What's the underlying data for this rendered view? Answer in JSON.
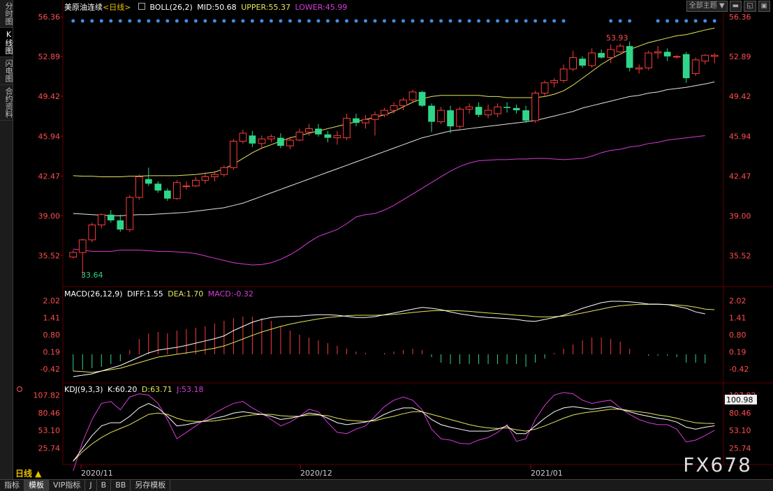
{
  "sidebar": {
    "tabs": [
      {
        "label": "分时图",
        "active": false
      },
      {
        "label": "K线图",
        "active": true
      },
      {
        "label": "闪电图",
        "active": false
      },
      {
        "label": "合约资料",
        "active": false
      }
    ]
  },
  "toolbar": {
    "theme_label": "全部主题",
    "theme_arrow": "▼"
  },
  "price_panel": {
    "instrument": "美原油连续",
    "period_tag": "<日线>",
    "indicator": "BOLL(26,2)",
    "mid": "MID:50.68",
    "upper": "UPPER:55.37",
    "lower": "LOWER:45.99",
    "y_ticks": [
      "56.36",
      "52.89",
      "49.42",
      "45.94",
      "42.47",
      "39.00",
      "35.52"
    ],
    "high_label": "53.93",
    "low_label": "33.64"
  },
  "macd_panel": {
    "indicator": "MACD(26,12,9)",
    "diff": "DIFF:1.55",
    "dea": "DEA:1.70",
    "macd": "MACD:-0.32",
    "y_ticks": [
      "2.02",
      "1.41",
      "0.80",
      "0.19",
      "-0.42"
    ]
  },
  "kdj_panel": {
    "indicator": "KDJ(9,3,3)",
    "k": "K:60.20",
    "d": "D:63.71",
    "j": "J:53.18",
    "y_ticks": [
      "107.82",
      "80.46",
      "53.10",
      "25.74"
    ],
    "current_value": "100.98"
  },
  "x_axis": {
    "labels": [
      "2020/11",
      "2020/12",
      "2021/01"
    ]
  },
  "period_button": "日线 ▲",
  "bottom_tabs": [
    "指标",
    "模板",
    "VIP指标",
    "J",
    "B",
    "BB",
    "另存模板"
  ],
  "bottom_active": "模板",
  "watermark": "FX678",
  "colors": {
    "up": "#ff3b3b",
    "down": "#2fd68a",
    "mid": "#e6e6e6",
    "upper": "#e6e65a",
    "lower": "#d93ad9",
    "diff": "#ffffff",
    "dea": "#e6e65a",
    "j": "#d93ad9",
    "k": "#ffffff",
    "d": "#e6e65a"
  },
  "chart_data": [
    {
      "type": "candlestick",
      "title": "美原油连续<日线>",
      "ylim": [
        33.0,
        56.36
      ],
      "candles": [
        [
          35.4,
          36.0,
          35.3,
          35.8
        ],
        [
          35.8,
          37.0,
          33.64,
          36.9
        ],
        [
          36.9,
          38.4,
          36.7,
          38.2
        ],
        [
          38.2,
          39.2,
          37.9,
          39.1
        ],
        [
          39.1,
          39.5,
          38.4,
          38.6
        ],
        [
          38.6,
          39.1,
          37.6,
          37.8
        ],
        [
          37.8,
          40.8,
          37.6,
          40.6
        ],
        [
          40.6,
          42.6,
          40.4,
          42.4
        ],
        [
          42.2,
          43.2,
          41.6,
          41.8
        ],
        [
          41.8,
          42.0,
          41.0,
          41.2
        ],
        [
          41.2,
          41.4,
          40.3,
          40.5
        ],
        [
          40.5,
          42.1,
          40.4,
          41.9
        ],
        [
          41.6,
          42.0,
          41.3,
          41.6
        ],
        [
          41.6,
          42.4,
          41.5,
          42.1
        ],
        [
          42.1,
          42.8,
          41.8,
          42.4
        ],
        [
          42.4,
          42.9,
          42.0,
          42.6
        ],
        [
          42.6,
          43.4,
          42.4,
          43.2
        ],
        [
          43.2,
          45.7,
          43.0,
          45.5
        ],
        [
          45.5,
          46.5,
          45.3,
          46.2
        ],
        [
          46.0,
          46.4,
          45.0,
          45.3
        ],
        [
          45.3,
          46.0,
          44.9,
          45.7
        ],
        [
          45.7,
          46.1,
          45.4,
          45.9
        ],
        [
          45.8,
          46.2,
          44.9,
          45.1
        ],
        [
          45.1,
          45.9,
          44.8,
          45.6
        ],
        [
          45.6,
          46.6,
          45.5,
          46.3
        ],
        [
          46.3,
          47.0,
          46.0,
          46.6
        ],
        [
          46.6,
          47.0,
          45.9,
          46.1
        ],
        [
          46.1,
          46.4,
          45.4,
          45.8
        ],
        [
          45.8,
          46.4,
          45.2,
          46.0
        ],
        [
          45.8,
          47.9,
          45.6,
          47.5
        ],
        [
          47.5,
          47.9,
          46.8,
          47.1
        ],
        [
          47.1,
          47.8,
          46.6,
          47.4
        ],
        [
          47.4,
          48.1,
          46.0,
          47.8
        ],
        [
          47.8,
          48.4,
          47.6,
          48.2
        ],
        [
          48.2,
          48.9,
          47.9,
          48.6
        ],
        [
          48.6,
          49.3,
          48.2,
          49.1
        ],
        [
          49.1,
          50.0,
          48.9,
          49.8
        ],
        [
          49.8,
          49.9,
          48.5,
          48.6
        ],
        [
          48.6,
          48.8,
          46.3,
          47.2
        ],
        [
          47.2,
          48.5,
          47.0,
          48.2
        ],
        [
          48.2,
          48.6,
          46.2,
          46.8
        ],
        [
          46.8,
          48.5,
          46.6,
          48.3
        ],
        [
          48.3,
          48.8,
          47.9,
          48.5
        ],
        [
          48.5,
          48.9,
          47.6,
          47.8
        ],
        [
          47.8,
          48.7,
          47.5,
          48.2
        ],
        [
          47.9,
          48.8,
          47.6,
          48.5
        ],
        [
          48.5,
          48.9,
          48.0,
          48.4
        ],
        [
          48.4,
          48.7,
          47.9,
          48.2
        ],
        [
          48.2,
          48.6,
          47.1,
          47.3
        ],
        [
          47.3,
          49.9,
          47.1,
          49.7
        ],
        [
          49.7,
          50.8,
          49.4,
          50.6
        ],
        [
          50.6,
          51.0,
          50.2,
          50.8
        ],
        [
          50.8,
          52.2,
          50.6,
          51.8
        ],
        [
          51.8,
          53.4,
          51.6,
          52.8
        ],
        [
          52.7,
          52.9,
          51.9,
          52.1
        ],
        [
          52.1,
          53.6,
          51.9,
          53.2
        ],
        [
          53.2,
          53.5,
          52.7,
          52.8
        ],
        [
          52.8,
          53.93,
          52.3,
          53.5
        ],
        [
          53.3,
          54.0,
          53.2,
          53.8
        ],
        [
          53.8,
          54.2,
          51.6,
          51.9
        ],
        [
          51.8,
          52.2,
          51.4,
          51.9
        ],
        [
          51.9,
          53.4,
          51.7,
          53.2
        ],
        [
          53.2,
          53.8,
          52.7,
          53.3
        ],
        [
          53.3,
          53.6,
          52.5,
          52.9
        ],
        [
          52.9,
          53.0,
          52.7,
          52.9
        ],
        [
          53.1,
          53.3,
          50.6,
          51.0
        ],
        [
          51.4,
          52.8,
          51.2,
          52.6
        ],
        [
          52.5,
          53.1,
          52.2,
          53.0
        ],
        [
          52.9,
          53.2,
          52.3,
          53.0
        ]
      ],
      "mid": [
        39.2,
        39.15,
        39.1,
        39.05,
        39.0,
        39.0,
        39.05,
        39.1,
        39.1,
        39.15,
        39.2,
        39.25,
        39.3,
        39.4,
        39.5,
        39.6,
        39.7,
        39.9,
        40.1,
        40.4,
        40.7,
        41.0,
        41.3,
        41.6,
        41.9,
        42.2,
        42.5,
        42.8,
        43.1,
        43.4,
        43.7,
        44.0,
        44.3,
        44.6,
        44.9,
        45.2,
        45.5,
        45.8,
        46.0,
        46.2,
        46.4,
        46.5,
        46.6,
        46.7,
        46.8,
        46.9,
        47.0,
        47.1,
        47.2,
        47.3,
        47.5,
        47.7,
        47.9,
        48.1,
        48.4,
        48.6,
        48.8,
        49.0,
        49.2,
        49.4,
        49.5,
        49.7,
        49.8,
        50.0,
        50.1,
        50.2,
        50.35,
        50.5,
        50.68
      ],
      "upper": [
        42.5,
        42.45,
        42.45,
        42.4,
        42.4,
        42.4,
        42.45,
        42.45,
        42.5,
        42.5,
        42.5,
        42.5,
        42.55,
        42.6,
        42.7,
        42.8,
        43.1,
        43.5,
        44.0,
        44.5,
        44.9,
        45.2,
        45.5,
        45.8,
        46.0,
        46.2,
        46.4,
        46.6,
        46.8,
        47.0,
        47.2,
        47.4,
        47.6,
        47.8,
        48.1,
        48.5,
        48.9,
        49.2,
        49.4,
        49.5,
        49.5,
        49.5,
        49.5,
        49.5,
        49.4,
        49.4,
        49.3,
        49.3,
        49.3,
        49.3,
        49.4,
        49.6,
        49.9,
        50.4,
        51.0,
        51.6,
        52.2,
        52.7,
        53.1,
        53.5,
        53.8,
        54.1,
        54.3,
        54.5,
        54.7,
        54.8,
        55.0,
        55.2,
        55.37
      ],
      "lower": [
        36.1,
        36.0,
        35.9,
        35.9,
        35.9,
        36.0,
        36.0,
        36.0,
        35.95,
        35.9,
        35.9,
        35.85,
        35.8,
        35.7,
        35.5,
        35.3,
        35.1,
        34.9,
        34.8,
        34.7,
        34.75,
        34.9,
        35.2,
        35.6,
        36.1,
        36.7,
        37.2,
        37.5,
        37.8,
        38.3,
        38.9,
        39.1,
        39.2,
        39.5,
        39.9,
        40.4,
        40.9,
        41.4,
        41.9,
        42.4,
        42.9,
        43.3,
        43.6,
        43.8,
        43.85,
        43.9,
        43.9,
        43.95,
        43.95,
        44.0,
        44.0,
        43.95,
        43.9,
        43.95,
        44.0,
        44.2,
        44.5,
        44.7,
        44.8,
        45.0,
        45.1,
        45.3,
        45.4,
        45.6,
        45.7,
        45.8,
        45.9,
        45.99
      ]
    },
    {
      "type": "bar+line",
      "title": "MACD(26,12,9)",
      "ylim": [
        -0.85,
        2.2
      ],
      "hist": [
        -0.6,
        -0.55,
        -0.5,
        -0.45,
        -0.35,
        -0.25,
        0.15,
        0.55,
        0.75,
        0.8,
        0.75,
        0.85,
        0.9,
        0.95,
        1.0,
        1.1,
        1.2,
        1.3,
        1.35,
        1.35,
        1.3,
        1.2,
        1.0,
        0.85,
        0.7,
        0.6,
        0.5,
        0.4,
        0.3,
        0.2,
        0.1,
        0.05,
        0.0,
        0.05,
        0.1,
        0.15,
        0.2,
        0.15,
        -0.1,
        -0.3,
        -0.35,
        -0.35,
        -0.35,
        -0.35,
        -0.35,
        -0.35,
        -0.35,
        -0.35,
        -0.45,
        -0.3,
        -0.15,
        0.05,
        0.2,
        0.35,
        0.5,
        0.6,
        0.6,
        0.55,
        0.45,
        0.2,
        0.0,
        -0.05,
        -0.05,
        -0.05,
        -0.1,
        -0.3,
        -0.3,
        -0.32
      ],
      "diff": [
        -0.7,
        -0.65,
        -0.6,
        -0.5,
        -0.4,
        -0.3,
        -0.15,
        0.0,
        0.15,
        0.25,
        0.3,
        0.35,
        0.42,
        0.5,
        0.58,
        0.66,
        0.76,
        0.95,
        1.1,
        1.25,
        1.35,
        1.42,
        1.45,
        1.46,
        1.47,
        1.5,
        1.52,
        1.52,
        1.5,
        1.46,
        1.42,
        1.42,
        1.45,
        1.52,
        1.58,
        1.65,
        1.72,
        1.78,
        1.75,
        1.7,
        1.62,
        1.55,
        1.5,
        1.45,
        1.42,
        1.4,
        1.38,
        1.35,
        1.3,
        1.28,
        1.35,
        1.42,
        1.5,
        1.62,
        1.75,
        1.85,
        1.95,
        2.0,
        2.0,
        1.98,
        1.95,
        1.9,
        1.9,
        1.88,
        1.82,
        1.75,
        1.62,
        1.55
      ],
      "dea": [
        -0.5,
        -0.52,
        -0.55,
        -0.5,
        -0.45,
        -0.4,
        -0.3,
        -0.2,
        -0.1,
        0.0,
        0.05,
        0.1,
        0.15,
        0.2,
        0.26,
        0.32,
        0.4,
        0.52,
        0.65,
        0.78,
        0.9,
        1.0,
        1.1,
        1.18,
        1.25,
        1.31,
        1.37,
        1.42,
        1.45,
        1.48,
        1.5,
        1.5,
        1.5,
        1.51,
        1.53,
        1.56,
        1.6,
        1.63,
        1.66,
        1.67,
        1.67,
        1.66,
        1.64,
        1.61,
        1.58,
        1.56,
        1.53,
        1.5,
        1.48,
        1.45,
        1.44,
        1.45,
        1.47,
        1.52,
        1.58,
        1.65,
        1.72,
        1.79,
        1.84,
        1.87,
        1.89,
        1.89,
        1.89,
        1.88,
        1.87,
        1.84,
        1.79,
        1.72,
        1.7
      ]
    },
    {
      "type": "line",
      "title": "KDJ(9,3,3)",
      "ylim": [
        0,
        115
      ],
      "k": [
        5,
        25,
        45,
        60,
        65,
        65,
        75,
        88,
        95,
        88,
        75,
        60,
        62,
        65,
        68,
        72,
        75,
        80,
        82,
        80,
        78,
        75,
        70,
        72,
        75,
        80,
        78,
        72,
        65,
        62,
        64,
        66,
        70,
        78,
        84,
        88,
        88,
        82,
        70,
        62,
        58,
        55,
        52,
        52,
        52,
        55,
        60,
        48,
        48,
        60,
        72,
        82,
        88,
        90,
        88,
        86,
        88,
        90,
        86,
        82,
        78,
        75,
        72,
        70,
        66,
        58,
        55,
        58,
        60.2
      ],
      "d": [
        5,
        20,
        32,
        42,
        50,
        56,
        62,
        70,
        78,
        80,
        78,
        72,
        68,
        67,
        67,
        68,
        70,
        72,
        75,
        77,
        78,
        78,
        76,
        75,
        75,
        77,
        77,
        76,
        72,
        69,
        68,
        67,
        68,
        72,
        75,
        79,
        82,
        82,
        78,
        74,
        70,
        66,
        62,
        59,
        57,
        56,
        57,
        54,
        52,
        55,
        60,
        66,
        72,
        77,
        80,
        82,
        84,
        86,
        86,
        84,
        82,
        80,
        77,
        75,
        72,
        68,
        65,
        64,
        63.71
      ],
      "j": [
        -10,
        35,
        70,
        95,
        98,
        85,
        105,
        110,
        108,
        95,
        70,
        40,
        50,
        60,
        70,
        80,
        88,
        95,
        98,
        88,
        80,
        70,
        60,
        66,
        75,
        86,
        82,
        65,
        50,
        48,
        55,
        60,
        75,
        90,
        100,
        105,
        100,
        85,
        55,
        40,
        38,
        33,
        32,
        38,
        42,
        50,
        62,
        36,
        40,
        70,
        92,
        108,
        112,
        110,
        100,
        95,
        98,
        100,
        88,
        78,
        70,
        65,
        62,
        62,
        55,
        35,
        38,
        45,
        53.18
      ]
    }
  ]
}
